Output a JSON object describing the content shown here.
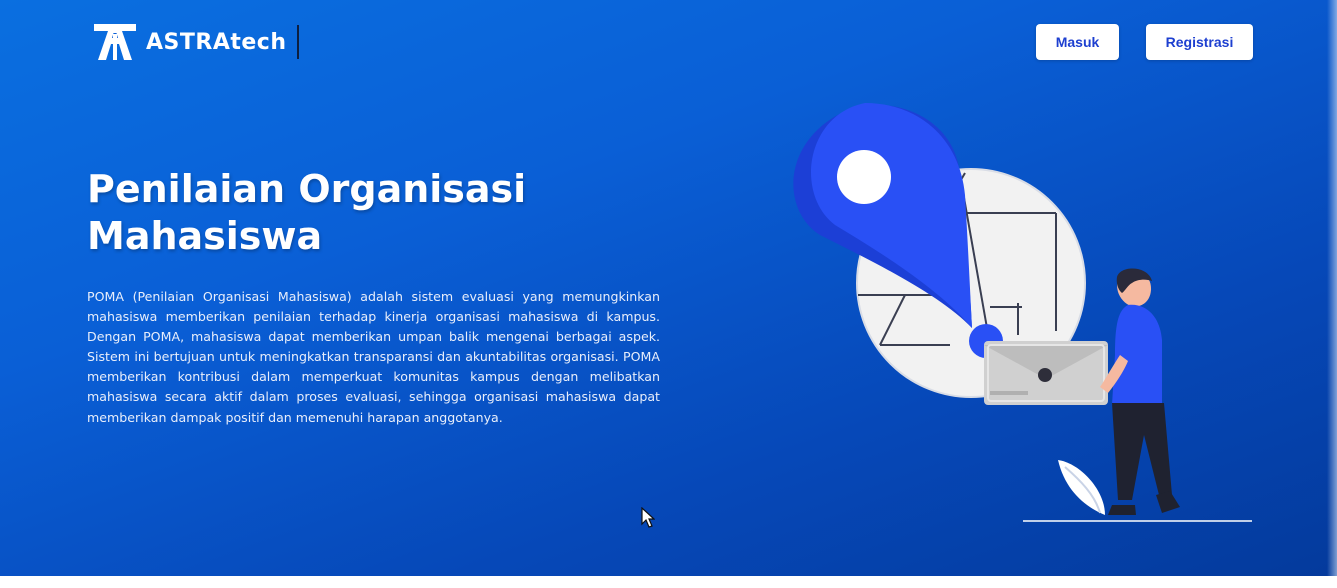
{
  "navbar": {
    "logo_text": "ASTRAtech",
    "login_label": "Masuk",
    "register_label": "Registrasi"
  },
  "hero": {
    "title_line1": "Penilaian Organisasi",
    "title_line2": "Mahasiswa",
    "description": "POMA (Penilaian Organisasi Mahasiswa) adalah sistem evaluasi yang memungkinkan mahasiswa memberikan penilaian terhadap kinerja organisasi mahasiswa di kampus. Dengan POMA, mahasiswa dapat memberikan umpan balik mengenai berbagai aspek. Sistem ini bertujuan untuk meningkatkan transparansi dan akuntabilitas organisasi. POMA memberikan kontribusi dalam memperkuat komunitas kampus dengan melibatkan mahasiswa secara aktif dalam proses evaluasi, sehingga organisasi mahasiswa dapat memberikan dampak positif dan memenuhi harapan anggotanya."
  },
  "icons": {
    "logo": "astratech-logo-icon",
    "illustration": "location-pin-illustration",
    "cursor": "mouse-pointer-icon"
  },
  "colors": {
    "hero_gradient_start": "#0a6fe0",
    "hero_gradient_end": "#043a9c",
    "button_bg": "#ffffff",
    "button_text": "#1d3fd0",
    "pin_blue": "#1f4df0"
  }
}
